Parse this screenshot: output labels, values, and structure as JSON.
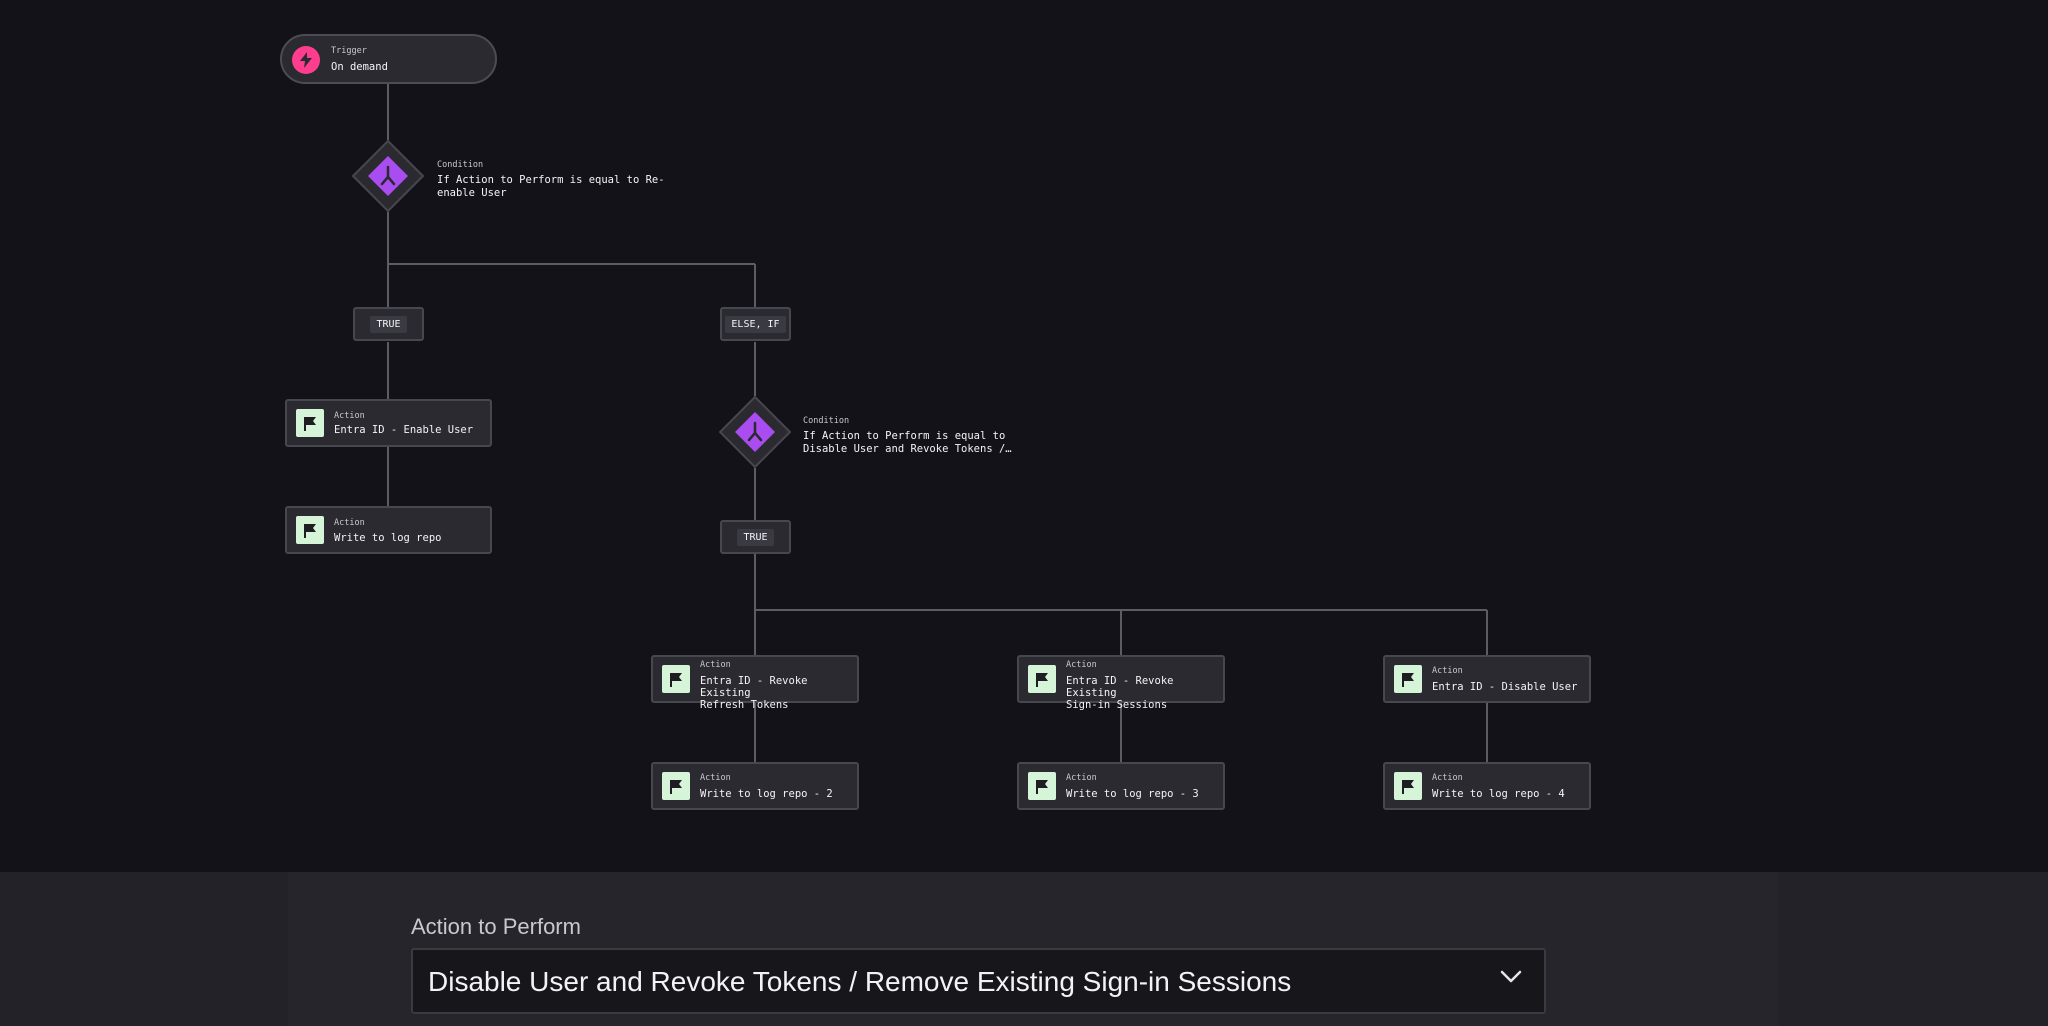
{
  "workflow": {
    "trigger": {
      "kind": "Trigger",
      "name": "On demand",
      "icon": "lightning-bolt-icon"
    },
    "conditions": [
      {
        "kind": "Condition",
        "name": "If Action to Perform is equal to Re-\nenable User",
        "icon": "branch-icon"
      },
      {
        "kind": "Condition",
        "name": "If Action to Perform is equal to\nDisable User and Revoke Tokens /…",
        "icon": "branch-icon"
      }
    ],
    "branches": [
      "TRUE",
      "ELSE, IF",
      "TRUE"
    ],
    "actions": [
      {
        "kind": "Action",
        "name": "Entra ID - Enable User",
        "icon": "flag-icon"
      },
      {
        "kind": "Action",
        "name": "Write to log repo",
        "icon": "flag-icon"
      },
      {
        "kind": "Action",
        "name": "Entra ID - Revoke Existing\nRefresh Tokens",
        "icon": "flag-icon"
      },
      {
        "kind": "Action",
        "name": "Entra ID - Revoke Existing\nSign-in Sessions",
        "icon": "flag-icon"
      },
      {
        "kind": "Action",
        "name": "Entra ID - Disable User",
        "icon": "flag-icon"
      },
      {
        "kind": "Action",
        "name": "Write to log repo - 2",
        "icon": "flag-icon"
      },
      {
        "kind": "Action",
        "name": "Write to log repo - 3",
        "icon": "flag-icon"
      },
      {
        "kind": "Action",
        "name": "Write to log repo - 4",
        "icon": "flag-icon"
      }
    ]
  },
  "form": {
    "label": "Action to Perform",
    "selected": "Disable User and Revoke Tokens / Remove Existing Sign-in Sessions",
    "chevron_icon": "chevron-down-icon"
  },
  "colors": {
    "canvas_bg": "#131218",
    "node_bg": "#2a2a30",
    "node_border": "#47474f",
    "connector": "#5c5c64",
    "trigger_accent": "#ff3d8f",
    "condition_accent": "#a94df0",
    "action_icon_bg": "#d6f5d8"
  }
}
